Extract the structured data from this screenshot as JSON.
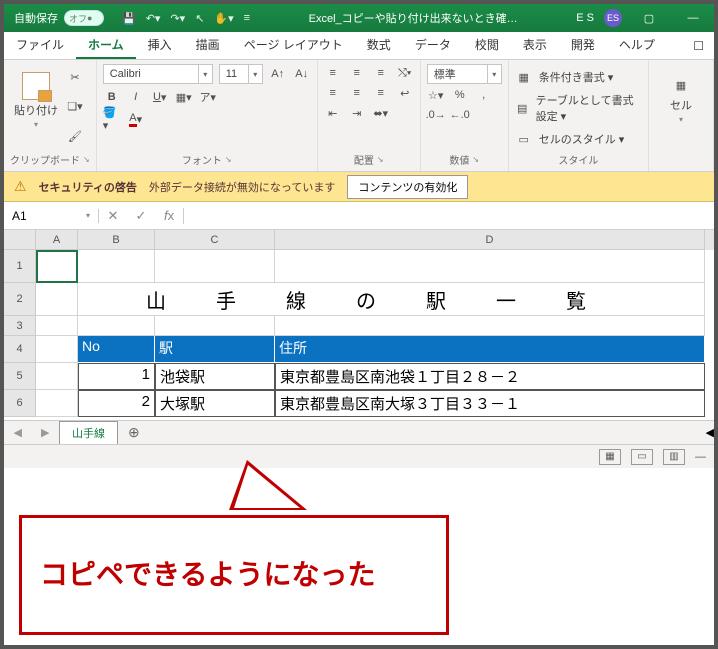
{
  "title": {
    "autosave_label": "自動保存",
    "toggle_state": "オフ",
    "filename": "Excel_コピーや貼り付け出来ないとき確…",
    "user_initials_text": "E S",
    "avatar_text": "ES"
  },
  "tabs": {
    "file": "ファイル",
    "home": "ホーム",
    "insert": "挿入",
    "draw": "描画",
    "layout": "ページ レイアウト",
    "formulas": "数式",
    "data": "データ",
    "review": "校閲",
    "view": "表示",
    "developer": "開発",
    "help": "ヘルプ"
  },
  "ribbon": {
    "clipboard": {
      "label": "クリップボード",
      "paste": "貼り付け"
    },
    "font": {
      "label": "フォント",
      "name": "Calibri",
      "size": "11"
    },
    "align": {
      "label": "配置"
    },
    "number": {
      "label": "数値",
      "format": "標準"
    },
    "styles": {
      "label": "スタイル",
      "cond": "条件付き書式 ▾",
      "table": "テーブルとして書式設定 ▾",
      "cell": "セルのスタイル ▾"
    },
    "cells": {
      "label": "セル"
    }
  },
  "security": {
    "title": "セキュリティの啓告",
    "message": "外部データ接続が無効になっています",
    "button": "コンテンツの有効化"
  },
  "formula": {
    "cellref": "A1",
    "value": ""
  },
  "cols": {
    "A": "A",
    "B": "B",
    "C": "C",
    "D": "D"
  },
  "rows": {
    "r1": "1",
    "r2": "2",
    "r3": "3",
    "r4": "4",
    "r5": "5",
    "r6": "6"
  },
  "sheet": {
    "title_text": "山手線の駅一覧",
    "headers": {
      "no": "No",
      "station": "駅",
      "address": "住所"
    },
    "data": [
      {
        "no": "1",
        "station": "池袋駅",
        "address": "東京都豊島区南池袋１丁目２８－２"
      },
      {
        "no": "2",
        "station": "大塚駅",
        "address": "東京都豊島区南大塚３丁目３３－１"
      }
    ]
  },
  "tabsheet": {
    "name": "山手線"
  },
  "callout": {
    "text": "コピペできるようになった"
  }
}
